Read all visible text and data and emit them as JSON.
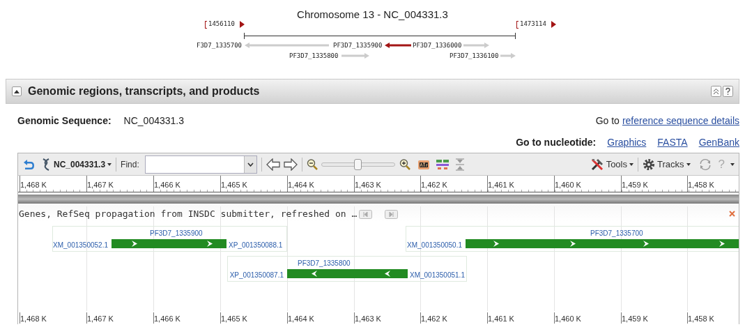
{
  "overview": {
    "title": "Chromosome 13 - NC_004331.3",
    "range_start": "1456110",
    "range_end": "1473114",
    "genes": [
      {
        "label": "F3D7_1335700",
        "reverse": true,
        "selected": false
      },
      {
        "label": "PF3D7_1335900",
        "reverse": true,
        "selected": true
      },
      {
        "label": "PF3D7_1336000",
        "reverse": false,
        "selected": false
      },
      {
        "label": "PF3D7_1335800",
        "reverse": false,
        "selected": false
      },
      {
        "label": "PF3D7_1336100",
        "reverse": false,
        "selected": false
      }
    ]
  },
  "section": {
    "title": "Genomic regions, transcripts, and products",
    "expanded": true
  },
  "genomic_sequence": {
    "label": "Genomic Sequence:",
    "value": "NC_004331.3"
  },
  "reference_link": {
    "prefix": "Go to",
    "link": "reference sequence details"
  },
  "nucleotide_links": {
    "label": "Go to nucleotide:",
    "links": [
      "Graphics",
      "FASTA",
      "GenBank"
    ]
  },
  "viewer": {
    "toolbar": {
      "sequence": "NC_004331.3",
      "find_label": "Find:",
      "zoom": {
        "level": 0.5
      },
      "tools": "Tools",
      "tracks": "Tracks",
      "help": "?"
    },
    "ruler_top": [
      "1,468 K",
      "1,467 K",
      "1,466 K",
      "1,465 K",
      "1,464 K",
      "1,463 K",
      "1,462 K",
      "1,461 K",
      "1,460 K",
      "1,459 K",
      "1,458 K"
    ],
    "track": {
      "title": "Genes, RefSeq propagation from INSDC submitter, refreshed on …"
    },
    "genes": [
      {
        "name": "PF3D7_1335900",
        "left_label": "XM_001350052.1",
        "right_label": "XP_001350088.1",
        "reverse": false
      },
      {
        "name": "PF3D7_1335800",
        "left_label": "XP_001350087.1",
        "right_label": "XM_001350051.1",
        "reverse": true
      },
      {
        "name": "PF3D7_1335700",
        "left_label": "XM_001350050.1",
        "reverse": false
      }
    ],
    "ruler_bottom": [
      "1,468 K",
      "1,467 K",
      "1,466 K",
      "1,465 K",
      "1,464 K",
      "1,463 K",
      "1,462 K",
      "1,461 K",
      "1,460 K",
      "1,459 K",
      "1,458 K"
    ]
  }
}
